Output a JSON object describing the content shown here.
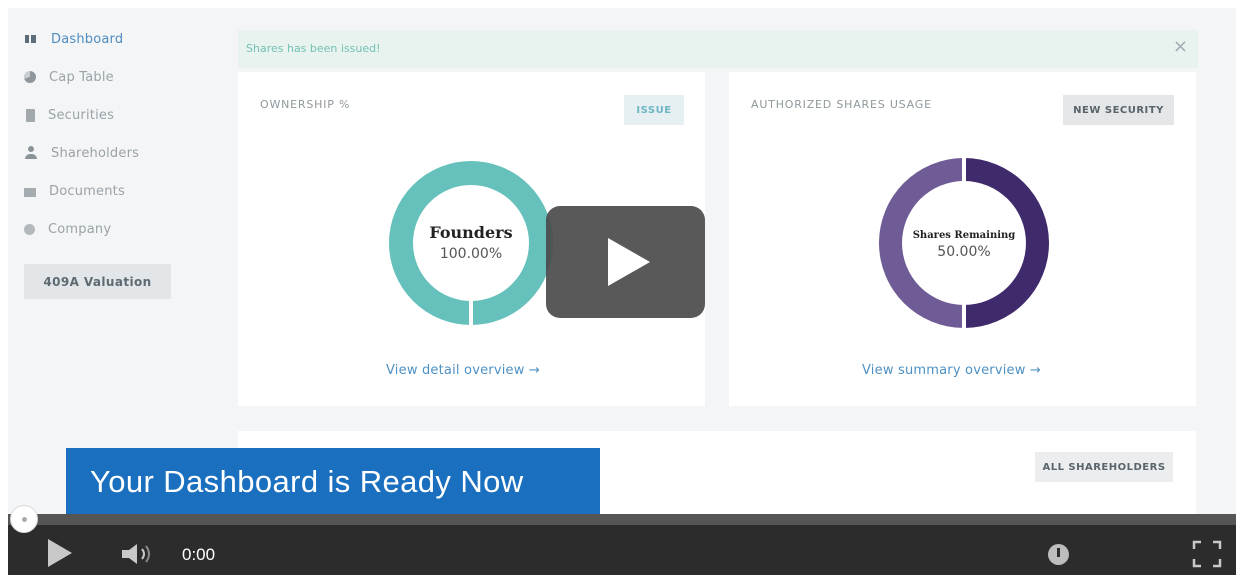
{
  "sidebar": {
    "items": [
      {
        "label": "Dashboard",
        "icon": "dashboard-icon",
        "active": true
      },
      {
        "label": "Cap Table",
        "icon": "pie-chart-icon",
        "active": false
      },
      {
        "label": "Securities",
        "icon": "clipboard-icon",
        "active": false
      },
      {
        "label": "Shareholders",
        "icon": "user-icon",
        "active": false
      },
      {
        "label": "Documents",
        "icon": "document-icon",
        "active": false
      },
      {
        "label": "Company",
        "icon": "gear-icon",
        "active": false
      }
    ],
    "valuation_button": "409A Valuation"
  },
  "alert": {
    "message": "Shares has been issued!",
    "close_icon": "close-icon"
  },
  "ownership": {
    "title": "OWNERSHIP %",
    "button": "ISSUE",
    "center_label": "Founders",
    "center_value": "100.00%",
    "share_percent": 100,
    "color": "#66c1bc",
    "link": "View detail overview →"
  },
  "authorized": {
    "title": "AUTHORIZED SHARES USAGE",
    "button": "NEW SECURITY",
    "center_label": "Shares Remaining",
    "center_value": "50.00%",
    "remaining_percent": 50,
    "colors": [
      "#3f2a6c",
      "#6f5c96"
    ],
    "link": "View summary overview →"
  },
  "shareholders": {
    "button": "ALL SHAREHOLDERS"
  },
  "banner": {
    "text": "Your Dashboard is Ready Now",
    "color": "#1a6fbf"
  },
  "player": {
    "time": "0:00",
    "progress": 0,
    "icons": [
      "play-icon",
      "volume-icon",
      "speed-icon",
      "fullscreen-icon",
      "big-play-icon"
    ]
  }
}
